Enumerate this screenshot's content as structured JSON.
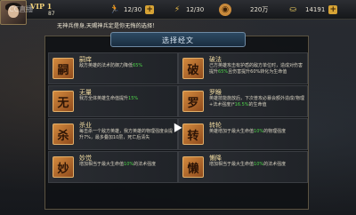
{
  "player": {
    "vip": "VIP 1",
    "level": "87",
    "watermark": "CC直播"
  },
  "resources": [
    {
      "icon": "stamina-runner-icon",
      "value": "12/30",
      "color": "#4aa3ff"
    },
    {
      "icon": "energy-lightning-icon",
      "value": "12/30",
      "color": "#f2c14a"
    },
    {
      "icon": "copper-coin-icon",
      "value": "220万",
      "color": "#c98a3b"
    },
    {
      "icon": "gold-ingot-icon",
      "value": "14191",
      "color": "#f0d060"
    }
  ],
  "notice": "无神兵傍身,天赐神兵定是你无悔的选择！",
  "dialog": {
    "title": "选择经文",
    "cards": [
      {
        "glyph": "嗣",
        "name": "嗣痒",
        "desc_pre": "敌方英雄的法术防御力降低",
        "highlight": "65%",
        "desc_post": ""
      },
      {
        "glyph": "破",
        "name": "破法",
        "desc_pre": "己方英雄攻击有护盾的敌方单位时，造成对伤害提升",
        "highlight": "65%",
        "desc_post": "且伤害提升60%转化为生命值"
      },
      {
        "glyph": "无",
        "name": "无量",
        "desc_pre": "我方全体英雄生命值提升",
        "highlight": "15%",
        "desc_post": ""
      },
      {
        "glyph": "罗",
        "name": "罗睺",
        "desc_pre": "英雄技能施放后，下次普攻必暴会额外造成(物理+法术强度)*",
        "highlight": "16.5%",
        "desc_post": "的生命值"
      },
      {
        "glyph": "杀",
        "name": "杀业",
        "desc_pre": "每击杀一个敌方英雄，我方英雄的物理强度会提升7%，最多叠加10层，死亡后清失",
        "highlight": "",
        "desc_post": ""
      },
      {
        "glyph": "转",
        "name": "转轮",
        "desc_pre": "英雄增加于最大生命值",
        "highlight": "10%",
        "desc_post": "的物理强度"
      },
      {
        "glyph": "妙",
        "name": "妙觉",
        "desc_pre": "增加相当于最大生命值",
        "highlight": "10%",
        "desc_post": "的法术强度"
      },
      {
        "glyph": "懒",
        "name": "懒降",
        "desc_pre": "增加相当于最大生命值",
        "highlight": "10%",
        "desc_post": "的法术强度"
      }
    ]
  }
}
